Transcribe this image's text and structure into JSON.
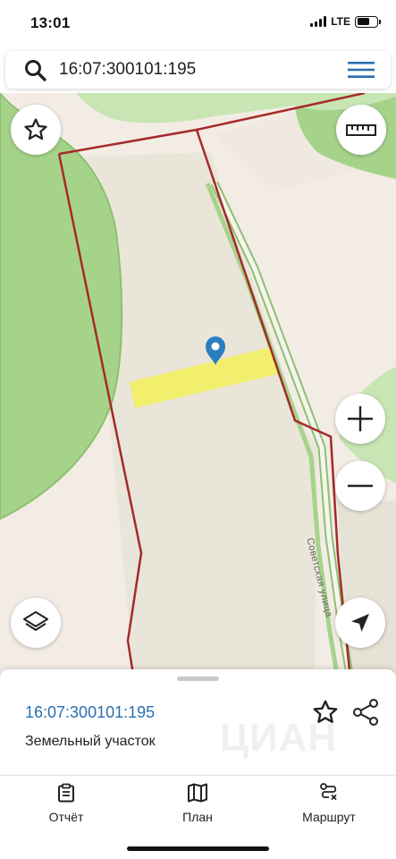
{
  "status_bar": {
    "time": "13:01",
    "network": "LTE",
    "battery_level": 0.65
  },
  "search": {
    "value": "16:07:300101:195",
    "icon": "search-icon",
    "menu_icon": "hamburger-menu-icon"
  },
  "map": {
    "street_label": "Советская улица",
    "colors": {
      "background": "#f3ece5",
      "forest": "#a6d38a",
      "meadow": "#c8e6b4",
      "field": "#e9e5d8",
      "parcel_highlight": "#f2ee6e",
      "boundary": "#a52a2a",
      "marker": "#2a7fc1"
    },
    "controls": {
      "favorite": "star-icon",
      "ruler": "ruler-icon",
      "zoom_in": "plus-icon",
      "zoom_out": "minus-icon",
      "layers": "layers-icon",
      "locate": "navigation-arrow-icon"
    }
  },
  "parcel": {
    "number": "16:07:300101:195",
    "type": "Земельный участок",
    "watermark": "ЦИАН",
    "actions": {
      "favorite": "star-outline-icon",
      "share": "share-icon"
    }
  },
  "tabs": [
    {
      "label": "Отчёт",
      "icon": "clipboard-icon"
    },
    {
      "label": "План",
      "icon": "map-icon"
    },
    {
      "label": "Маршрут",
      "icon": "route-icon"
    }
  ]
}
